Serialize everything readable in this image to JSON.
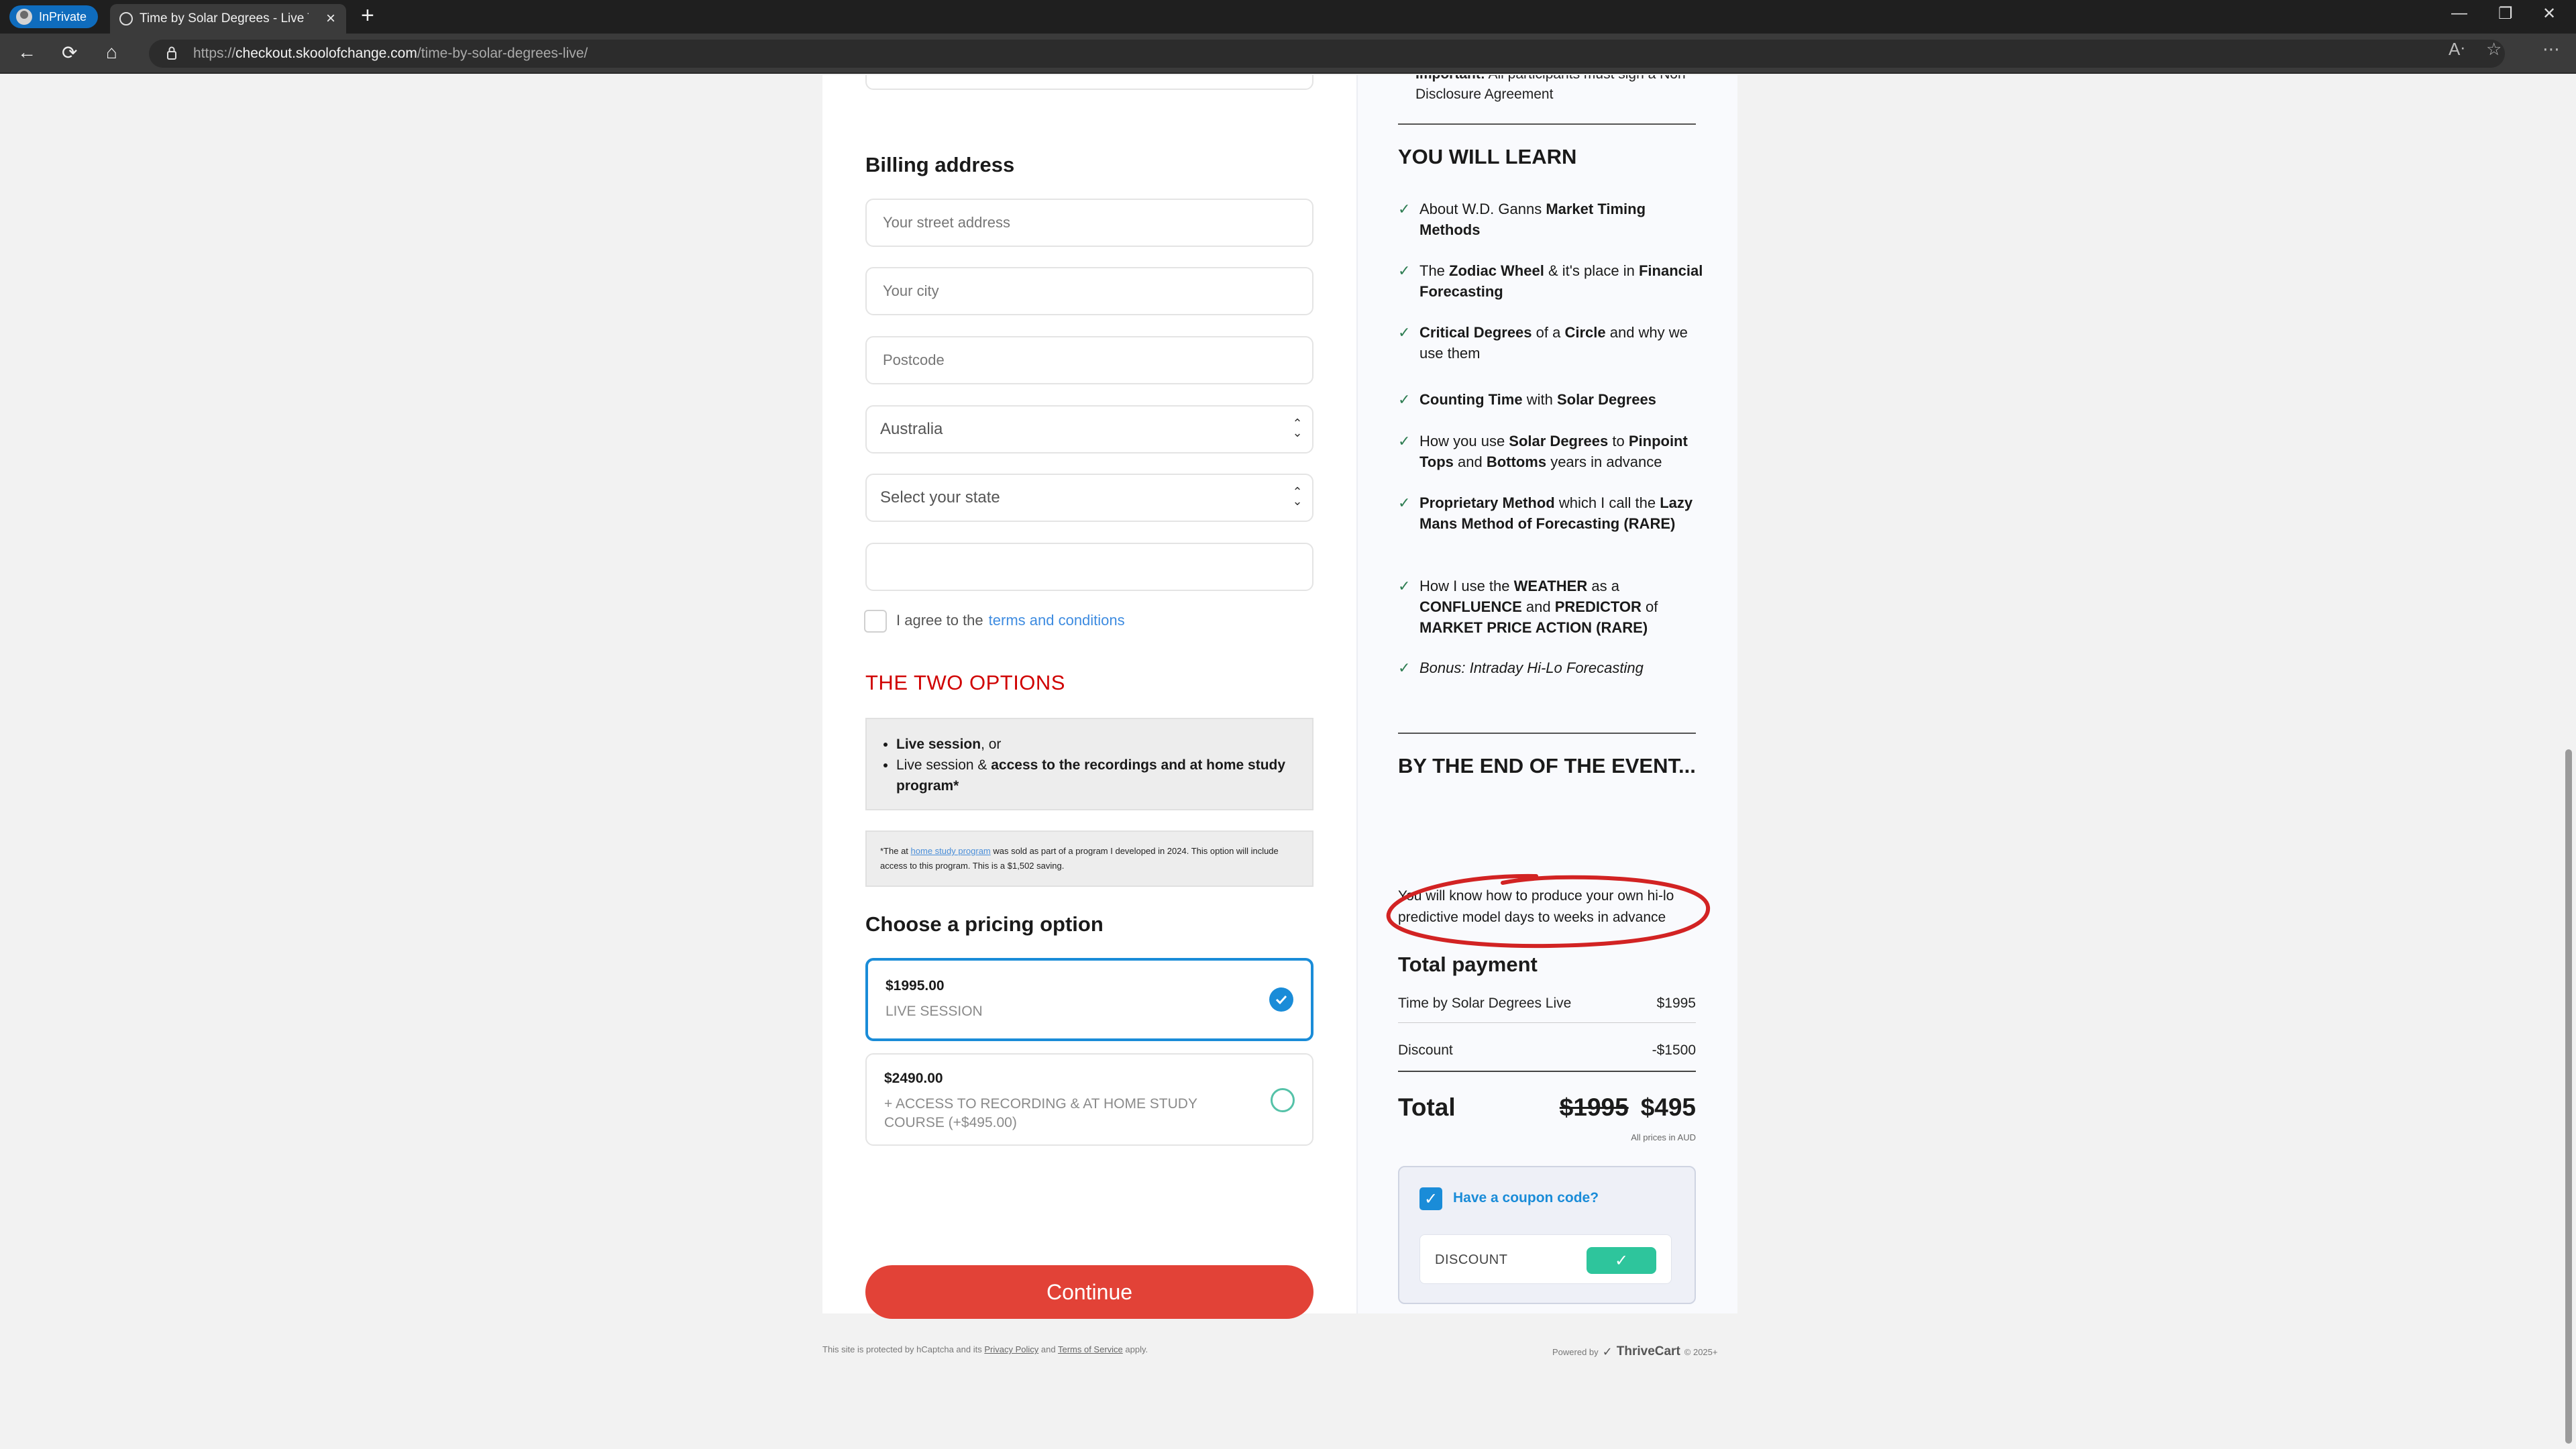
{
  "browser": {
    "inprivate_label": "InPrivate",
    "tab_title": "Time by Solar Degrees - Live Training",
    "url_prefix": "https://",
    "url_host": "checkout.skoolofchange.com",
    "url_path": "/time-by-solar-degrees-live/"
  },
  "billing": {
    "heading": "Billing address",
    "street_placeholder": "Your street address",
    "city_placeholder": "Your city",
    "postcode_placeholder": "Postcode",
    "country_value": "Australia",
    "state_placeholder": "Select your state",
    "agree_text": "I agree to the",
    "terms_link": "terms and conditions"
  },
  "options": {
    "heading": "THE TWO OPTIONS",
    "item1_bold": "Live session",
    "item1_rest": ", or",
    "item2_plain": "Live session & ",
    "item2_bold": "access to the recordings and at home study program*",
    "note_pre": "*The at ",
    "note_link": "home study program",
    "note_post": " was sold as part of a program I developed in 2024. This option will include access to this program. This is a $1,502 saving."
  },
  "pricing": {
    "heading": "Choose a pricing option",
    "opt1_amount": "$1995.00",
    "opt1_desc": "LIVE SESSION",
    "opt2_amount": "$2490.00",
    "opt2_desc": "+ ACCESS TO RECORDING & AT HOME STUDY COURSE (+$495.00)",
    "continue_label": "Continue",
    "selected_color": "#1a8cd8"
  },
  "sidebar": {
    "important_bold": "Important:",
    "important_rest": " All participants must sign a Non-Disclosure Agreement",
    "learn_heading": "YOU WILL LEARN",
    "learn": [
      {
        "p1": "About W.D. Ganns ",
        "b1": "Market Timing Methods"
      },
      {
        "p1": "The ",
        "b1": "Zodiac Wheel",
        "p2": " & it's place in ",
        "b2": "Financial Forecasting"
      },
      {
        "b1": "Critical Degrees",
        "p1": " of a ",
        "b2": "Circle",
        "p2": " and why we use them"
      },
      {
        "b1": "Counting Time",
        "p1": " with ",
        "b2": "Solar Degrees"
      },
      {
        "p1": "How you use ",
        "b1": "Solar Degrees",
        "p2": " to ",
        "b2": "Pinpoint Tops",
        "p3": " and ",
        "b3": "Bottoms",
        "p4": " years in advance"
      },
      {
        "b1": "Proprietary Method",
        "p1": " which I call the ",
        "b2": "Lazy Mans Method of Forecasting (RARE)"
      },
      {
        "p1": "How I use the ",
        "b1": "WEATHER",
        "p2": " as a ",
        "b2": "CONFLUENCE",
        "p3": " and ",
        "b3": "PREDICTOR",
        "p4": " of ",
        "b4": "MARKET PRICE ACTION (RARE)"
      },
      {
        "i1": "Bonus: Intraday Hi-Lo Forecasting"
      }
    ],
    "end_heading": "BY THE END OF THE EVENT...",
    "end_text": "You will know how to produce your own hi-lo predictive model days to weeks in advance",
    "ring_color": "#d22323"
  },
  "summary": {
    "heading": "Total payment",
    "item_label": "Time by Solar Degrees Live",
    "item_price": "$1995",
    "discount_label": "Discount",
    "discount_value": "-$1500",
    "total_label": "Total",
    "total_old": "$1995",
    "total_new": "$495",
    "currency_note": "All prices in AUD",
    "coupon_label": "Have a coupon code?",
    "coupon_value": "DISCOUNT"
  },
  "footer": {
    "left_pre": "This site is protected by hCaptcha and its ",
    "privacy": "Privacy Policy",
    "and": " and ",
    "tos": "Terms of Service",
    "apply": " apply.",
    "powered": "Powered by",
    "brand": "ThriveCart",
    "year": "© 2025+"
  }
}
